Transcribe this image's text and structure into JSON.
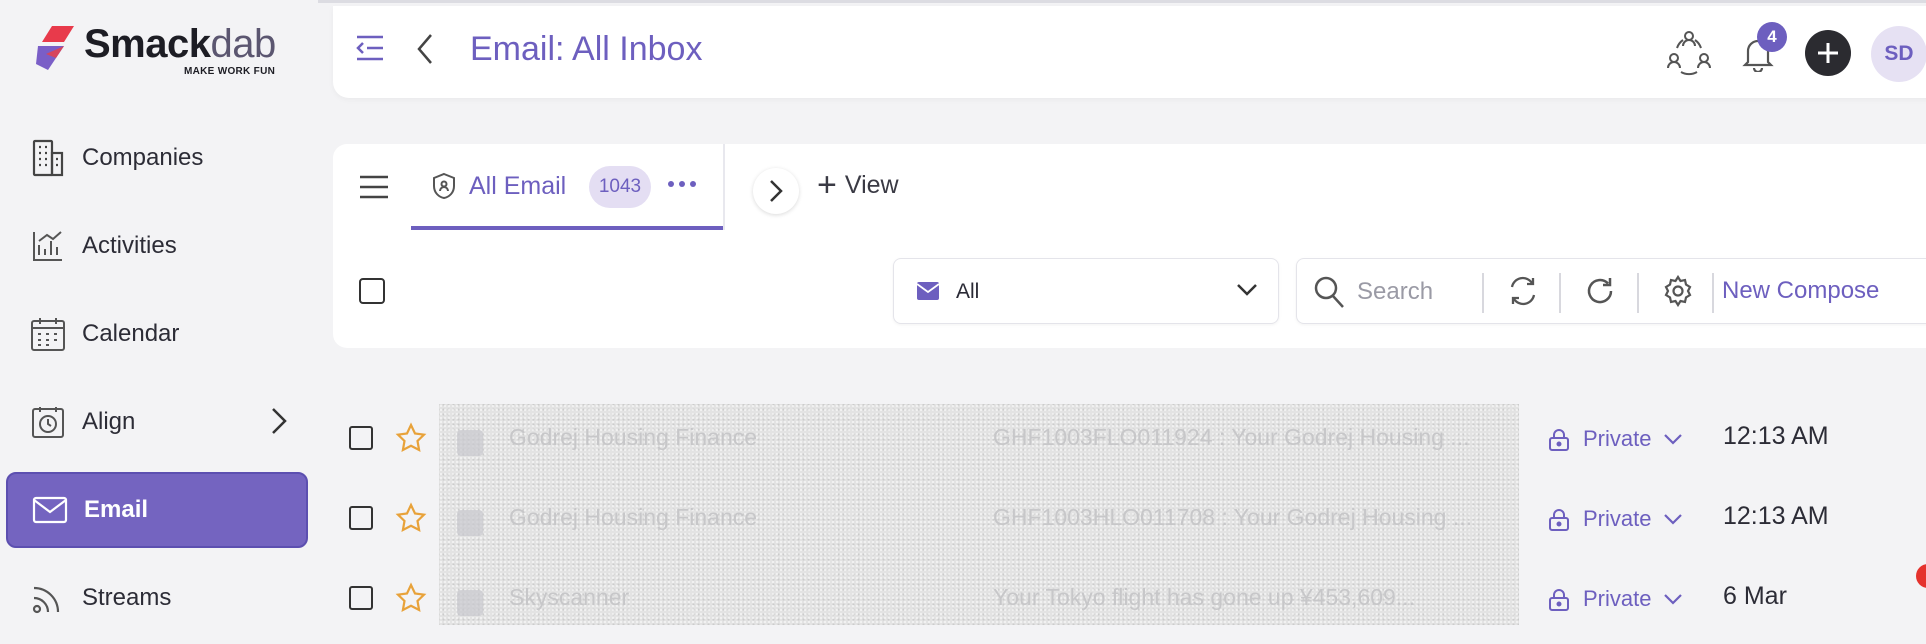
{
  "brand": {
    "name_bold": "Smack",
    "name_light": "dab",
    "tagline": "MAKE WORK FUN",
    "accent": "#6d5fbf"
  },
  "sidebar": {
    "items": [
      {
        "label": "Companies",
        "icon": "building-icon"
      },
      {
        "label": "Activities",
        "icon": "activities-chart-icon"
      },
      {
        "label": "Calendar",
        "icon": "calendar-icon"
      },
      {
        "label": "Align",
        "icon": "clock-calendar-icon",
        "has_submenu": true
      },
      {
        "label": "Email",
        "icon": "mail-icon",
        "active": true
      },
      {
        "label": "Streams",
        "icon": "streams-icon"
      }
    ]
  },
  "header": {
    "title": "Email: All Inbox",
    "notification_count": "4",
    "avatar_initials": "SD"
  },
  "tabs": {
    "active": {
      "label": "All Email",
      "count": "1043"
    },
    "add_view_label": "View"
  },
  "toolbar": {
    "filter_value": "All",
    "search_placeholder": "Search",
    "compose_label": "New Compose"
  },
  "emails": [
    {
      "sender": "Godrej Housing Finance",
      "subject": "GHF1003FLO011924 : Your Godrej Housing ...",
      "visibility": "Private",
      "time": "12:13 AM"
    },
    {
      "sender": "Godrej Housing Finance",
      "subject": "GHF1003HLO011708 : Your Godrej Housing ...",
      "visibility": "Private",
      "time": "12:13 AM"
    },
    {
      "sender": "Skyscanner",
      "subject": "Your Tokyo flight has gone up ¥453,609...",
      "visibility": "Private",
      "time": "6 Mar"
    }
  ]
}
